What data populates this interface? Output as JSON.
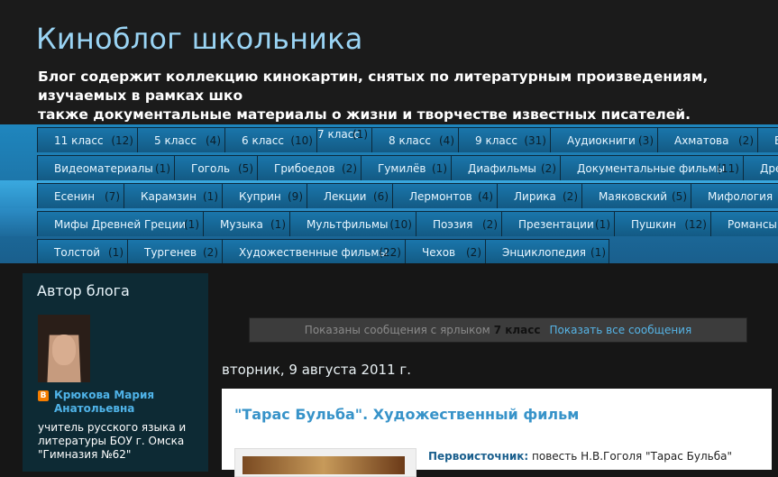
{
  "header": {
    "title": "Киноблог школьника",
    "description": "Блог содержит коллекцию кинокартин, снятых по литературным произведениям, изучаемых в рамках шко\nтакже документальные материалы о жизни и творчестве известных писателей."
  },
  "labels": [
    [
      [
        "11 класс",
        "(12)"
      ],
      [
        "5 класс",
        "(4)"
      ],
      [
        "6 класс",
        "(10)"
      ],
      [
        "7 класс",
        "(1)"
      ],
      [
        "8 класс",
        "(4)"
      ],
      [
        "9 класс",
        "(31)"
      ],
      [
        "Аудиокниги",
        "(3)"
      ],
      [
        "Ахматова",
        "(2)"
      ],
      [
        "Б",
        ""
      ]
    ],
    [
      [
        "Видеоматериалы",
        "(1)"
      ],
      [
        "Гоголь",
        "(5)"
      ],
      [
        "Грибоедов",
        "(2)"
      ],
      [
        "Гумилёв",
        "(1)"
      ],
      [
        "Диафильмы",
        "(2)"
      ],
      [
        "Документальные фильмы",
        "(11)"
      ],
      [
        "Дре",
        ""
      ]
    ],
    [
      [
        "Есенин",
        "(7)"
      ],
      [
        "Карамзин",
        "(1)"
      ],
      [
        "Куприн",
        "(9)"
      ],
      [
        "Лекции",
        "(6)"
      ],
      [
        "Лермонтов",
        "(4)"
      ],
      [
        "Лирика",
        "(2)"
      ],
      [
        "Маяковский",
        "(5)"
      ],
      [
        "Мифология",
        ""
      ]
    ],
    [
      [
        "Мифы Древней Греции",
        "(1)"
      ],
      [
        "Музыка",
        "(1)"
      ],
      [
        "Мультфильмы",
        "(10)"
      ],
      [
        "Поэзия",
        "(2)"
      ],
      [
        "Презентации",
        "(1)"
      ],
      [
        "Пушкин",
        "(12)"
      ],
      [
        "Романсы",
        ""
      ]
    ],
    [
      [
        "Толстой",
        "(1)"
      ],
      [
        "Тургенев",
        "(2)"
      ],
      [
        "Художественные фильмы",
        "(22)"
      ],
      [
        "Чехов",
        "(2)"
      ],
      [
        "Энциклопедия",
        "(1)"
      ]
    ]
  ],
  "sidebar": {
    "title": "Автор блога",
    "author_name": "Крюкова Мария\nАнатольевна",
    "about": "учитель русского языка и\nлитературы БОУ г. Омска\n\"Гимназия №62\""
  },
  "status": {
    "prefix": "Показаны сообщения с ярлыком",
    "label": "7 класс",
    "show_all": "Показать все сообщения"
  },
  "post": {
    "date": "вторник, 9 августа 2011 г.",
    "title": "\"Тарас Бульба\". Художественный фильм",
    "source_label": "Первоисточник:",
    "source_text": " повесть Н.В.Гоголя \"Тарас Бульба\""
  },
  "colors": {
    "accent": "#3793c9",
    "header_title": "#9ad4f4",
    "label_bar": "#1a76ab",
    "sidebar_bg": "#0d2a34"
  }
}
